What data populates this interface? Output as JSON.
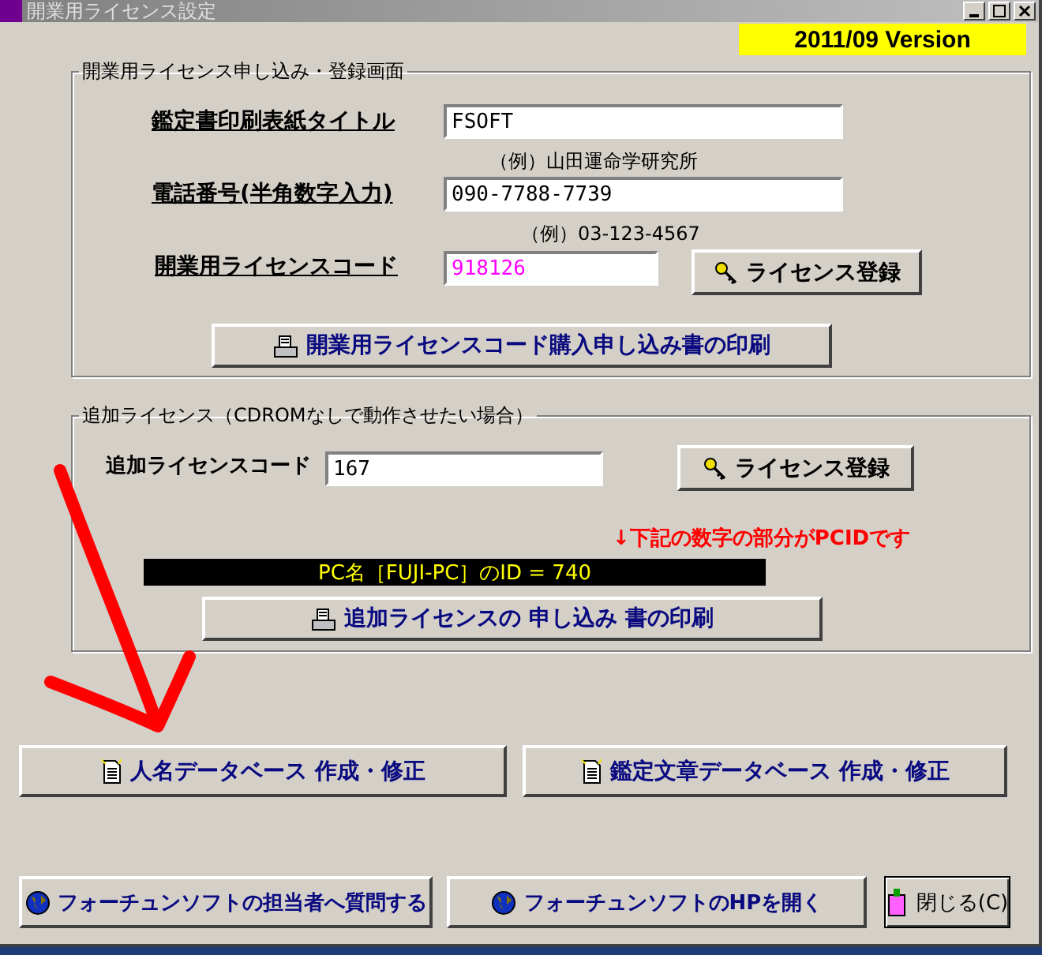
{
  "window": {
    "title": "開業用ライセンス設定",
    "version": "2011/09 Version"
  },
  "license_group": {
    "legend": "開業用ライセンス申し込み・登録画面",
    "fields": [
      {
        "label": "鑑定書印刷表紙タイトル",
        "value": "FSOFT",
        "hint": "（例）山田運命学研究所"
      },
      {
        "label": "電話番号(半角数字入力)",
        "value": "090-7788-7739",
        "hint": "（例）03-123-4567"
      }
    ],
    "code": {
      "label": "開業用ライセンスコード",
      "value": "918126"
    },
    "register_button": "ライセンス登録",
    "print_button": "開業用ライセンスコード購入申し込み書の印刷"
  },
  "additional_group": {
    "legend": "追加ライセンス（CDROMなしで動作させたい場合）",
    "code": {
      "label": "追加ライセンスコード",
      "value": "167"
    },
    "register_button": "ライセンス登録",
    "note": "↓下記の数字の部分がPCIDです",
    "pc_id": "PC名［FUJI-PC］のID = 740",
    "print_button": "追加ライセンスの 申し込み 書の印刷"
  },
  "database_buttons": [
    "人名データベース 作成・修正",
    "鑑定文章データベース 作成・修正"
  ],
  "footer_buttons": [
    "フォーチュンソフトの担当者へ質問する",
    "フォーチュンソフトのHPを開く"
  ],
  "close_button": "閉じる(C)"
}
